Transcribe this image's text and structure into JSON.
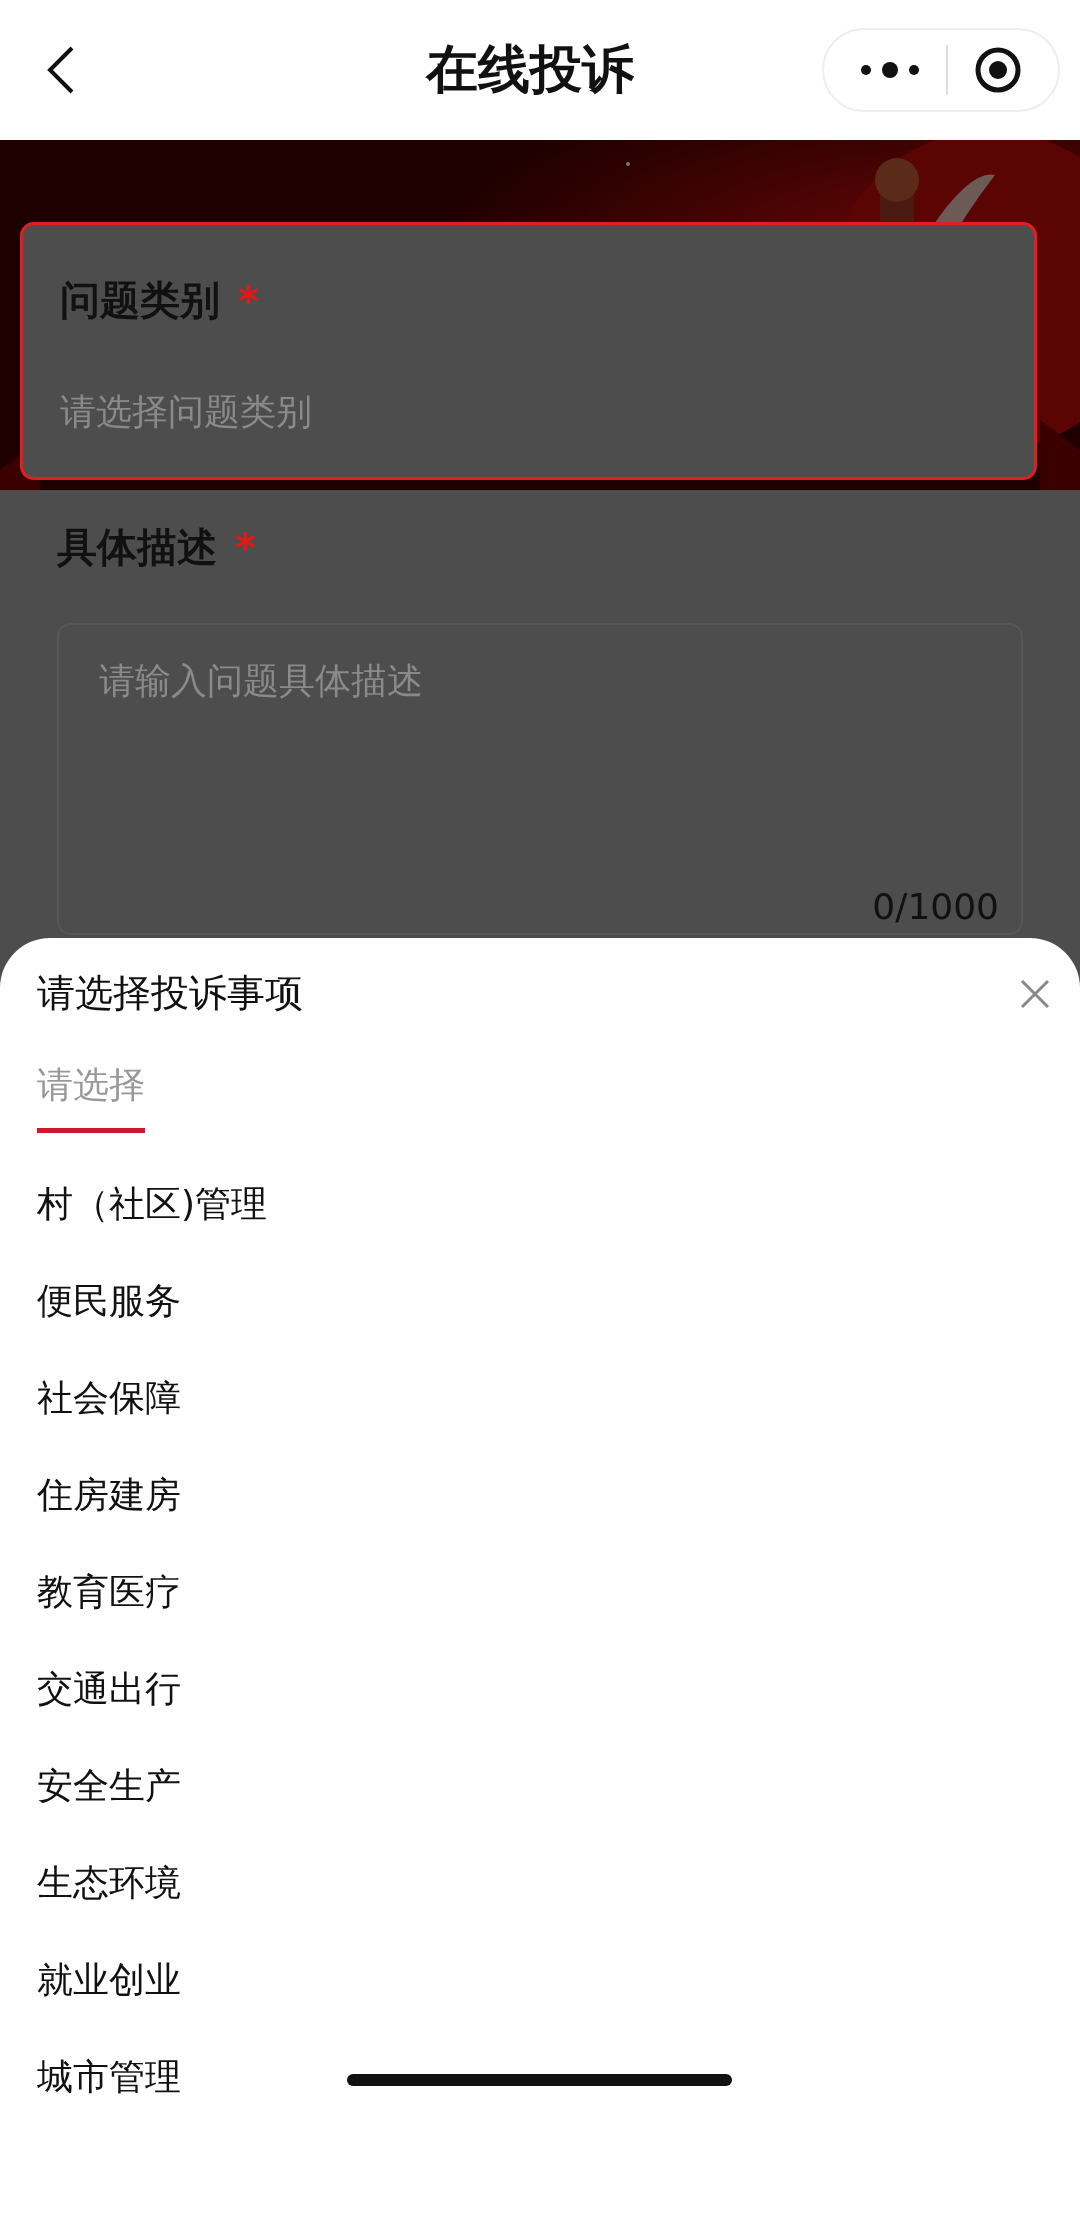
{
  "nav": {
    "title": "在线投诉"
  },
  "form": {
    "fields": [
      {
        "kind": "select",
        "label": "问题类别",
        "required_mark": "*",
        "placeholder": "请选择问题类别",
        "focused": true
      },
      {
        "kind": "textarea",
        "label": "具体描述",
        "required_mark": "*",
        "placeholder": "请输入问题具体描述",
        "counter": "0/1000",
        "focused": false
      }
    ]
  },
  "sheet": {
    "title": "请选择投诉事项",
    "tabs": [
      {
        "label": "请选择",
        "selected": true
      }
    ],
    "options": [
      "村（社区)管理",
      "便民服务",
      "社会保障",
      "住房建房",
      "教育医疗",
      "交通出行",
      "安全生产",
      "生态环境",
      "就业创业",
      "城市管理"
    ]
  }
}
